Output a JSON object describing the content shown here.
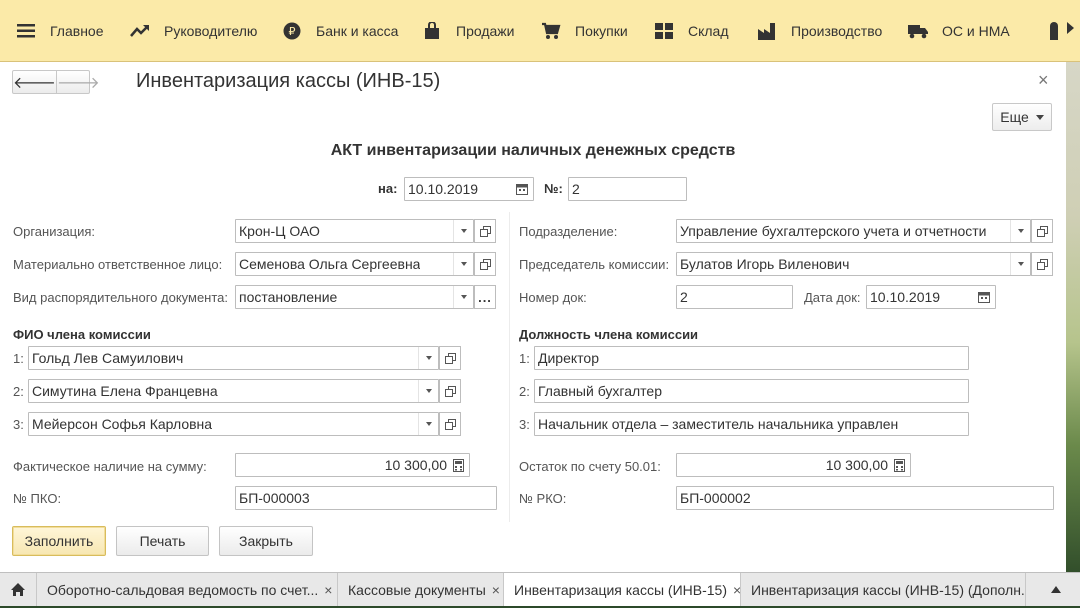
{
  "menu": {
    "items": [
      {
        "label": "Главное",
        "icon": "hamburger-icon"
      },
      {
        "label": "Руководителю",
        "icon": "trend-icon"
      },
      {
        "label": "Банк и касса",
        "icon": "ruble-icon"
      },
      {
        "label": "Продажи",
        "icon": "bag-icon"
      },
      {
        "label": "Покупки",
        "icon": "cart-icon"
      },
      {
        "label": "Склад",
        "icon": "grid-icon"
      },
      {
        "label": "Производство",
        "icon": "factory-icon"
      },
      {
        "label": "ОС и НМА",
        "icon": "truck-icon"
      }
    ]
  },
  "window": {
    "title": "Инвентаризация кассы (ИНВ-15)",
    "close": "×",
    "more_label": "Еще"
  },
  "doc": {
    "heading": "АКТ инвентаризации наличных денежных средств",
    "date_label": "на:",
    "date": "10.10.2019",
    "number_label": "№:",
    "number": "2"
  },
  "form": {
    "org_label": "Организация:",
    "org": "Крон-Ц ОАО",
    "mol_label": "Материально ответственное лицо:",
    "mol": "Семенова Ольга Сергеевна",
    "order_type_label": "Вид распорядительного документа:",
    "order_type": "постановление",
    "dept_label": "Подразделение:",
    "dept": "Управление бухгалтерского учета и отчетности",
    "chair_label": "Председатель комиссии:",
    "chair": "Булатов Игорь Виленович",
    "docnum_label": "Номер док:",
    "docnum": "2",
    "docdate_label": "Дата док:",
    "docdate": "10.10.2019",
    "members_header": "ФИО члена комиссии",
    "positions_header": "Должность члена комиссии",
    "members": [
      {
        "num": "1:",
        "name": "Гольд Лев Самуилович",
        "position": "Директор"
      },
      {
        "num": "2:",
        "name": "Симутина Елена Францевна",
        "position": "Главный бухгалтер"
      },
      {
        "num": "3:",
        "name": "Мейерсон Софья Карловна",
        "position": "Начальник отдела – заместитель начальника управлен"
      }
    ],
    "actual_label": "Фактическое наличие на сумму:",
    "actual": "10 300,00",
    "balance_label": "Остаток по счету 50.01:",
    "balance": "10 300,00",
    "pko_label": "№ ПКО:",
    "pko": "БП-000003",
    "rko_label": "№ РКО:",
    "rko": "БП-000002"
  },
  "buttons": {
    "fill": "Заполнить",
    "print": "Печать",
    "close": "Закрыть"
  },
  "tabs": [
    {
      "label": "Оборотно-сальдовая ведомость по счет...",
      "close": "×"
    },
    {
      "label": "Кассовые документы",
      "close": "×"
    },
    {
      "label": "Инвентаризация кассы (ИНВ-15)",
      "close": "×"
    },
    {
      "label": "Инвентаризация кассы (ИНВ-15) (Дополн...",
      "close": ""
    }
  ]
}
